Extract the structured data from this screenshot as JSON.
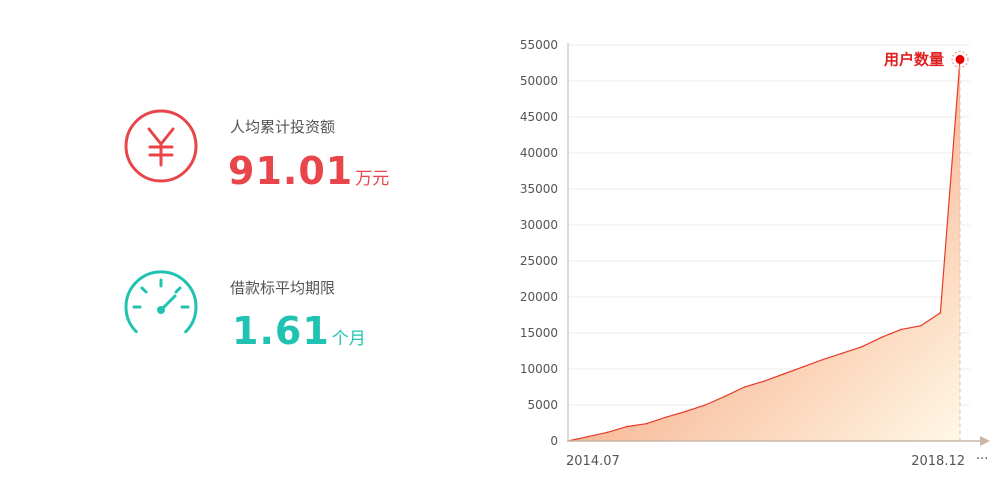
{
  "stats": [
    {
      "icon": "yuan-icon",
      "label": "人均累计投资额",
      "value": "91.01",
      "unit": "万元",
      "color": "#e8464b"
    },
    {
      "icon": "gauge-icon",
      "label": "借款标平均期限",
      "value": "1.61",
      "unit": "个月",
      "color": "#20c3b2"
    }
  ],
  "colors": {
    "line": "#e83b2a",
    "fill_start": "#f17a4a",
    "fill_end": "#fff8e6",
    "marker": "#e60000",
    "axis": "#c9b6a6"
  },
  "chart_data": {
    "type": "area",
    "title": "",
    "xlabel": "",
    "ylabel": "",
    "series_name": "用户数量",
    "x_start_label": "2014.07",
    "x_end_label": "2018.12",
    "x_more_label": "···",
    "ylim": [
      0,
      55000
    ],
    "yticks": [
      "0",
      "5000",
      "10000",
      "15000",
      "20000",
      "25000",
      "30000",
      "35000",
      "40000",
      "45000",
      "50000",
      "55000"
    ],
    "grid": true,
    "values": [
      0,
      600,
      1200,
      2000,
      2400,
      3300,
      4100,
      5000,
      6200,
      7500,
      8300,
      9300,
      10300,
      11300,
      12200,
      13100,
      14400,
      15500,
      16000,
      17800,
      53000
    ]
  }
}
